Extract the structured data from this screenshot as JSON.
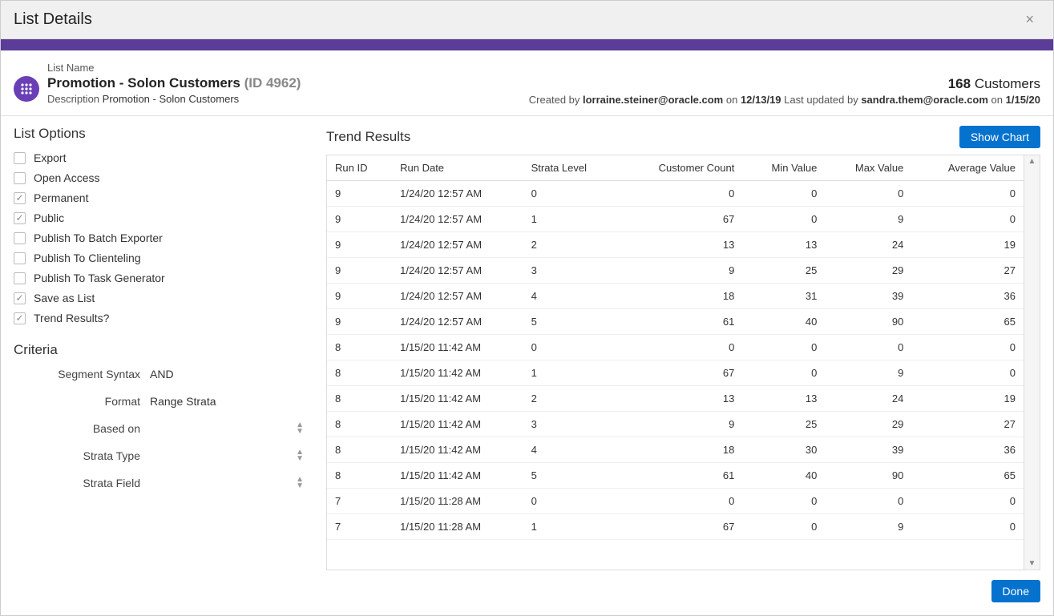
{
  "modal": {
    "title": "List Details",
    "close": "×"
  },
  "header": {
    "list_name_label": "List Name",
    "list_name": "Promotion - Solon Customers",
    "list_id_text": "(ID 4962)",
    "description_label": "Description",
    "description_value": "Promotion - Solon Customers",
    "customer_count": "168",
    "customer_label": "Customers",
    "created_by_prefix": "Created by ",
    "created_by_user": "lorraine.steiner@oracle.com",
    "created_on_conj": " on ",
    "created_on_date": "12/13/19",
    "updated_gap": "   ",
    "updated_by_prefix": "Last updated by ",
    "updated_by_user": "sandra.them@oracle.com",
    "updated_on_conj": " on ",
    "updated_on_date": "1/15/20"
  },
  "list_options": {
    "heading": "List Options",
    "items": [
      {
        "label": "Export",
        "checked": false
      },
      {
        "label": "Open Access",
        "checked": false
      },
      {
        "label": "Permanent",
        "checked": true
      },
      {
        "label": "Public",
        "checked": true
      },
      {
        "label": "Publish To Batch Exporter",
        "checked": false
      },
      {
        "label": "Publish To Clienteling",
        "checked": false
      },
      {
        "label": "Publish To Task Generator",
        "checked": false
      },
      {
        "label": "Save as List",
        "checked": true
      },
      {
        "label": "Trend Results?",
        "checked": true
      }
    ]
  },
  "criteria": {
    "heading": "Criteria",
    "rows": [
      {
        "label": "Segment Syntax",
        "value": "AND",
        "spinner": false
      },
      {
        "label": "Format",
        "value": "Range Strata",
        "spinner": false
      },
      {
        "label": "Based on",
        "value": "",
        "spinner": true
      },
      {
        "label": "Strata Type",
        "value": "",
        "spinner": true
      },
      {
        "label": "Strata Field",
        "value": "",
        "spinner": true
      }
    ]
  },
  "trend": {
    "heading": "Trend Results",
    "show_chart": "Show Chart",
    "columns": {
      "run_id": "Run ID",
      "run_date": "Run Date",
      "strata_level": "Strata Level",
      "customer_count": "Customer Count",
      "min_value": "Min Value",
      "max_value": "Max Value",
      "average_value": "Average Value"
    },
    "rows": [
      {
        "run_id": "9",
        "run_date": "1/24/20 12:57 AM",
        "strata": "0",
        "cust": "0",
        "min": "0",
        "max": "0",
        "avg": "0"
      },
      {
        "run_id": "9",
        "run_date": "1/24/20 12:57 AM",
        "strata": "1",
        "cust": "67",
        "min": "0",
        "max": "9",
        "avg": "0"
      },
      {
        "run_id": "9",
        "run_date": "1/24/20 12:57 AM",
        "strata": "2",
        "cust": "13",
        "min": "13",
        "max": "24",
        "avg": "19"
      },
      {
        "run_id": "9",
        "run_date": "1/24/20 12:57 AM",
        "strata": "3",
        "cust": "9",
        "min": "25",
        "max": "29",
        "avg": "27"
      },
      {
        "run_id": "9",
        "run_date": "1/24/20 12:57 AM",
        "strata": "4",
        "cust": "18",
        "min": "31",
        "max": "39",
        "avg": "36"
      },
      {
        "run_id": "9",
        "run_date": "1/24/20 12:57 AM",
        "strata": "5",
        "cust": "61",
        "min": "40",
        "max": "90",
        "avg": "65"
      },
      {
        "run_id": "8",
        "run_date": "1/15/20 11:42 AM",
        "strata": "0",
        "cust": "0",
        "min": "0",
        "max": "0",
        "avg": "0"
      },
      {
        "run_id": "8",
        "run_date": "1/15/20 11:42 AM",
        "strata": "1",
        "cust": "67",
        "min": "0",
        "max": "9",
        "avg": "0"
      },
      {
        "run_id": "8",
        "run_date": "1/15/20 11:42 AM",
        "strata": "2",
        "cust": "13",
        "min": "13",
        "max": "24",
        "avg": "19"
      },
      {
        "run_id": "8",
        "run_date": "1/15/20 11:42 AM",
        "strata": "3",
        "cust": "9",
        "min": "25",
        "max": "29",
        "avg": "27"
      },
      {
        "run_id": "8",
        "run_date": "1/15/20 11:42 AM",
        "strata": "4",
        "cust": "18",
        "min": "30",
        "max": "39",
        "avg": "36"
      },
      {
        "run_id": "8",
        "run_date": "1/15/20 11:42 AM",
        "strata": "5",
        "cust": "61",
        "min": "40",
        "max": "90",
        "avg": "65"
      },
      {
        "run_id": "7",
        "run_date": "1/15/20 11:28 AM",
        "strata": "0",
        "cust": "0",
        "min": "0",
        "max": "0",
        "avg": "0"
      },
      {
        "run_id": "7",
        "run_date": "1/15/20 11:28 AM",
        "strata": "1",
        "cust": "67",
        "min": "0",
        "max": "9",
        "avg": "0"
      }
    ]
  },
  "footer": {
    "done": "Done"
  }
}
